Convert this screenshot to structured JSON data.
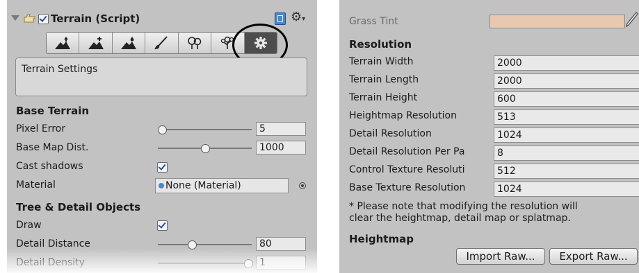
{
  "left": {
    "component_title": "Terrain (Script)",
    "tools": [
      {
        "name": "raise-lower-terrain",
        "icon": "mountain-up-icon"
      },
      {
        "name": "paint-height",
        "icon": "mountain-plus-icon"
      },
      {
        "name": "smooth-height",
        "icon": "mountain-drop-icon"
      },
      {
        "name": "paint-texture",
        "icon": "brush-icon"
      },
      {
        "name": "place-trees",
        "icon": "trees-icon"
      },
      {
        "name": "paint-details",
        "icon": "flower-icon"
      },
      {
        "name": "terrain-settings",
        "icon": "gear-icon",
        "active": true
      }
    ],
    "info_box": "Terrain Settings",
    "base_terrain": {
      "heading": "Base Terrain",
      "pixel_error_label": "Pixel Error",
      "pixel_error_value": "5",
      "pixel_error_level": 0.0,
      "base_map_label": "Base Map Dist.",
      "base_map_value": "1000",
      "base_map_level": 0.5,
      "cast_shadows_label": "Cast shadows",
      "cast_shadows_checked": true,
      "material_label": "Material",
      "material_value": "None (Material)"
    },
    "tree_detail": {
      "heading": "Tree & Detail Objects",
      "draw_label": "Draw",
      "draw_checked": true,
      "detail_distance_label": "Detail Distance",
      "detail_distance_value": "80",
      "detail_distance_level": 0.35,
      "detail_density_label": "Detail Density",
      "detail_density_value": "1",
      "detail_density_level": 1.0
    }
  },
  "right": {
    "grass_tint_label": "Grass Tint",
    "grass_tint_color": "#e9c8b1",
    "resolution_heading": "Resolution",
    "rows": [
      {
        "label": "Terrain Width",
        "value": "2000"
      },
      {
        "label": "Terrain Length",
        "value": "2000"
      },
      {
        "label": "Terrain Height",
        "value": "600"
      },
      {
        "label": "Heightmap Resolution",
        "value": "513"
      },
      {
        "label": "Detail Resolution",
        "value": "1024"
      },
      {
        "label": "Detail Resolution Per Pa",
        "value": "8"
      },
      {
        "label": "Control Texture Resoluti",
        "value": "512"
      },
      {
        "label": "Base Texture Resolution",
        "value": "1024"
      }
    ],
    "note_line1": "* Please note that modifying the resolution will",
    "note_line2": "clear the heightmap, detail map or splatmap.",
    "heightmap_heading": "Heightmap",
    "import_button": "Import Raw...",
    "export_button": "Export Raw..."
  }
}
